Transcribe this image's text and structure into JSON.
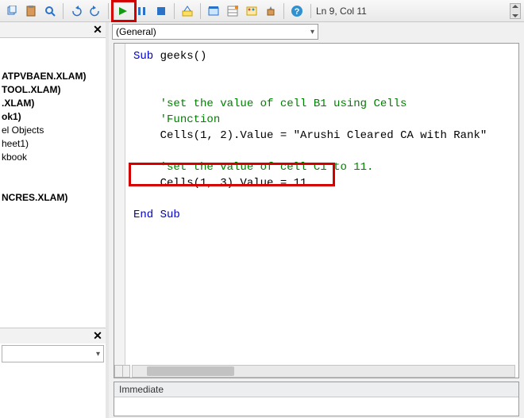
{
  "toolbar": {
    "position_label": "Ln 9, Col 11"
  },
  "tree": {
    "items": [
      {
        "label": "ATPVBAEN.XLAM)",
        "bold": true
      },
      {
        "label": "TOOL.XLAM)",
        "bold": true
      },
      {
        "label": ".XLAM)",
        "bold": true
      },
      {
        "label": "ok1)",
        "bold": true
      },
      {
        "label": "el Objects",
        "bold": false
      },
      {
        "label": "heet1)",
        "bold": false
      },
      {
        "label": "kbook",
        "bold": false
      },
      {
        "label": "",
        "bold": false
      },
      {
        "label": "",
        "bold": false
      },
      {
        "label": "NCRES.XLAM)",
        "bold": true
      }
    ]
  },
  "object_dropdown": {
    "selected": "(General)"
  },
  "code": {
    "l1": "Sub",
    "l1b": " geeks()",
    "l2": "",
    "l3": "",
    "c1": "'set the value of cell B1 using Cells",
    "c2": "'Function",
    "l4a": "Cells(1, 2).Value = ",
    "l4b": "\"Arushi Cleared CA with Rank\"",
    "c3": "'set the value of cell C1 to 11.",
    "l5": "Cells(1, 3).Value = 11",
    "l6": "End Sub"
  },
  "immediate": {
    "title": "Immediate"
  }
}
